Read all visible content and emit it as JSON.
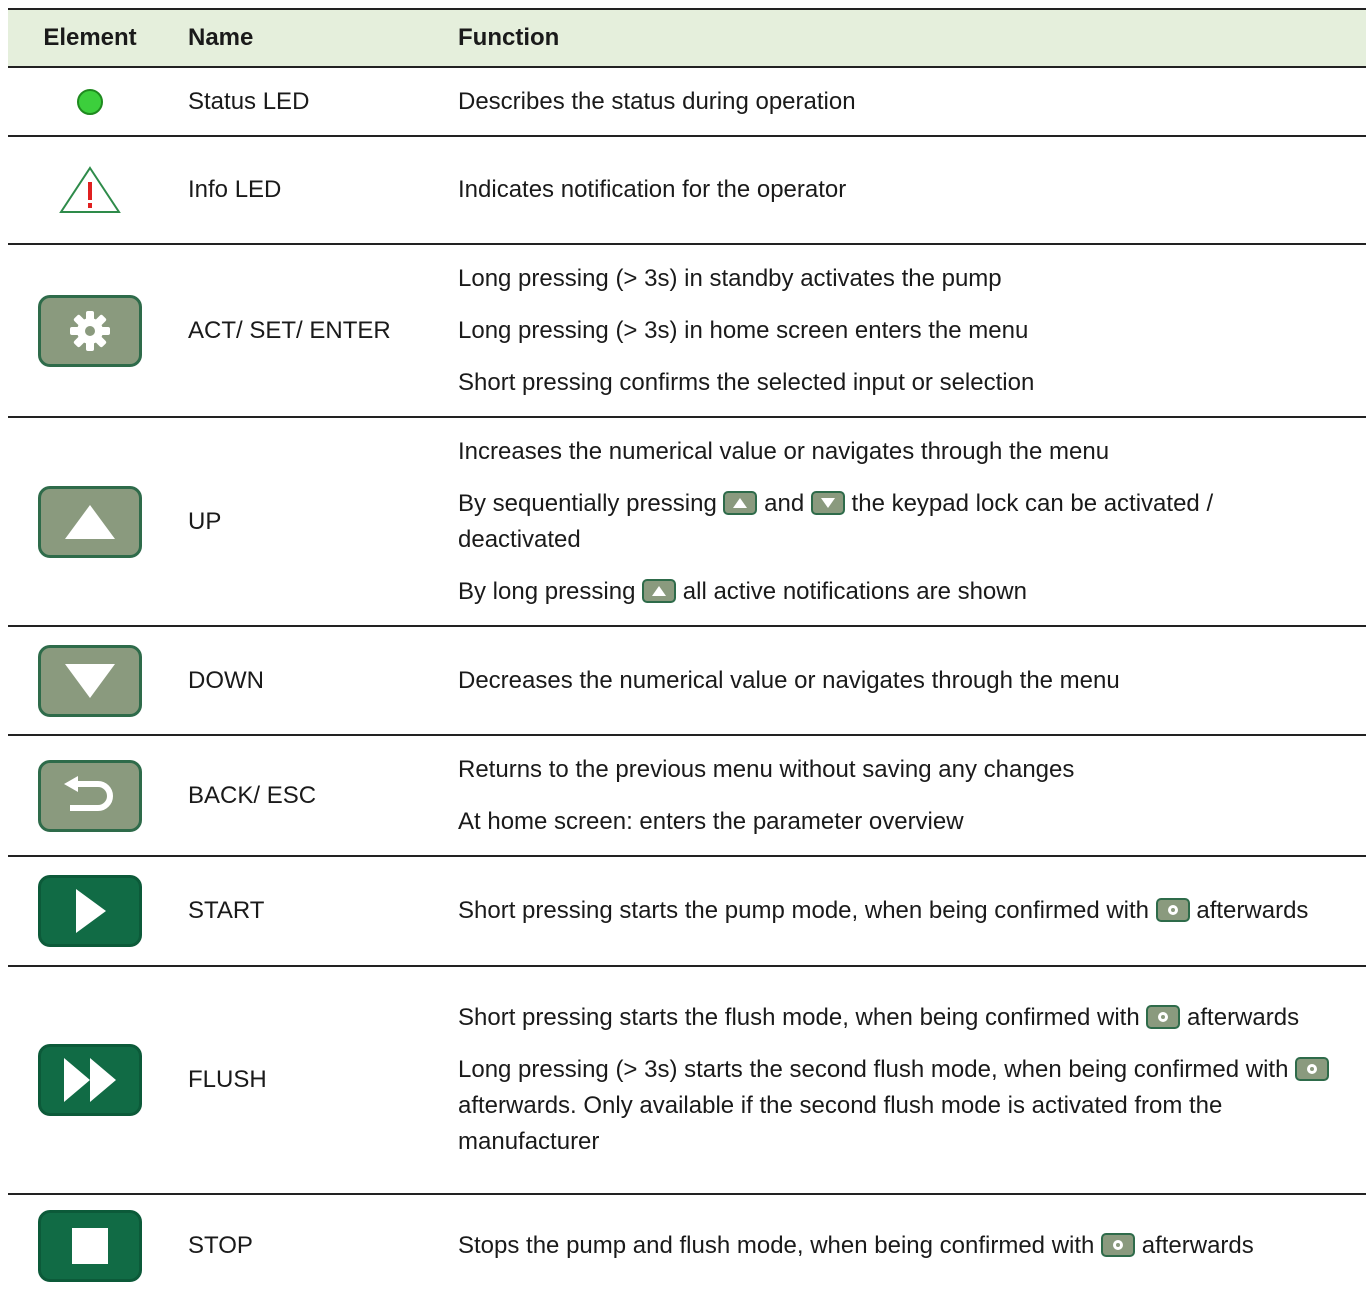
{
  "header": {
    "element": "Element",
    "name": "Name",
    "function": "Function"
  },
  "rows": [
    {
      "name": "Status LED",
      "icon": "green-led-icon",
      "functions": [
        "Describes the status during operation"
      ]
    },
    {
      "name": "Info LED",
      "icon": "warning-triangle-icon",
      "functions": [
        "Indicates notification for the operator"
      ]
    },
    {
      "name": "ACT/ SET/ ENTER",
      "icon": "gear-icon",
      "functions": [
        "Long pressing (> 3s) in standby activates the pump",
        "Long pressing (> 3s) in home screen enters the menu",
        "Short pressing confirms the selected input or selection"
      ]
    },
    {
      "name": "UP",
      "icon": "up-triangle-icon",
      "functions": [
        "Increases the numerical value or navigates through the menu",
        {
          "a": "By sequentially pressing",
          "b": "and",
          "c": "the keypad lock can be activated / deactivated"
        },
        {
          "a": "By long pressing",
          "b": "all active notifications are shown"
        }
      ]
    },
    {
      "name": "DOWN",
      "icon": "down-triangle-icon",
      "functions": [
        "Decreases the numerical value or navigates through the menu"
      ]
    },
    {
      "name": "BACK/ ESC",
      "icon": "return-arrow-icon",
      "functions": [
        "Returns to the previous menu without saving any changes",
        "At home screen: enters the parameter overview"
      ]
    },
    {
      "name": "START",
      "icon": "play-icon",
      "functions": [
        {
          "a": "Short pressing starts the pump mode, when being confirmed with",
          "b": "afterwards"
        }
      ]
    },
    {
      "name": "FLUSH",
      "icon": "fast-forward-icon",
      "functions": [
        {
          "a": "Short pressing starts the flush mode, when being confirmed with",
          "b": "afterwards"
        },
        {
          "a": "Long pressing (> 3s) starts the second flush mode, when being confirmed with",
          "b": "afterwards. Only available if the second flush mode is activated from the manufacturer"
        }
      ]
    },
    {
      "name": "STOP",
      "icon": "stop-square-icon",
      "functions": [
        {
          "a": "Stops the pump and flush mode, when being confirmed with",
          "b": "afterwards"
        }
      ]
    }
  ],
  "colors": {
    "header_bg": "#e5efdc",
    "gray_button": "#8a9a7e",
    "dark_button": "#116b45",
    "led_green": "#3ccf3c",
    "warning_red": "#e02020"
  }
}
